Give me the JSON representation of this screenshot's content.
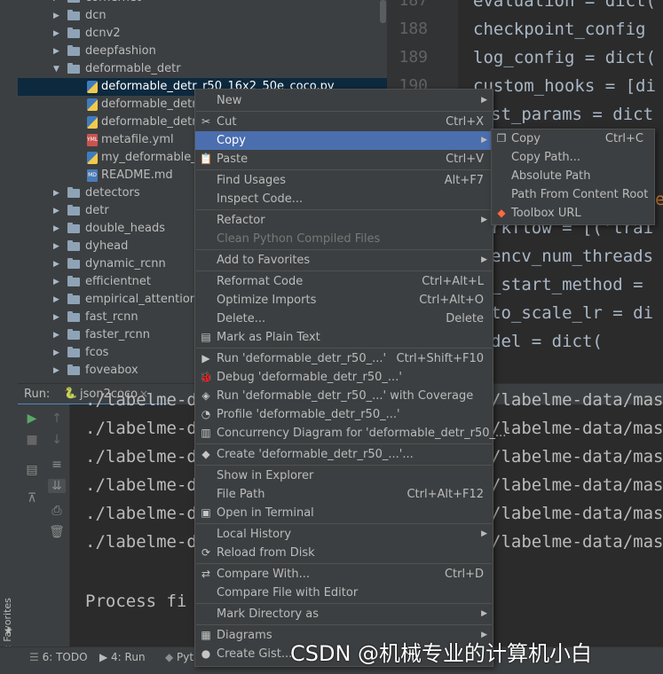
{
  "tree": {
    "items": [
      {
        "label": "cornernet",
        "type": "folder",
        "indent": 0,
        "expanded": false
      },
      {
        "label": "dcn",
        "type": "folder",
        "indent": 0,
        "expanded": false
      },
      {
        "label": "dcnv2",
        "type": "folder",
        "indent": 0,
        "expanded": false
      },
      {
        "label": "deepfashion",
        "type": "folder",
        "indent": 0,
        "expanded": false
      },
      {
        "label": "deformable_detr",
        "type": "folder",
        "indent": 0,
        "expanded": true
      },
      {
        "label": "deformable_detr_r50_16x2_50e_coco.py",
        "type": "py",
        "indent": 1,
        "selected": true
      },
      {
        "label": "deformable_detr_r",
        "type": "py",
        "indent": 1
      },
      {
        "label": "deformable_detr_t",
        "type": "py",
        "indent": 1
      },
      {
        "label": "metafile.yml",
        "type": "yml",
        "indent": 1
      },
      {
        "label": "my_deformable_de",
        "type": "py",
        "indent": 1
      },
      {
        "label": "README.md",
        "type": "md",
        "indent": 1
      },
      {
        "label": "detectors",
        "type": "folder",
        "indent": 0,
        "expanded": false
      },
      {
        "label": "detr",
        "type": "folder",
        "indent": 0,
        "expanded": false
      },
      {
        "label": "double_heads",
        "type": "folder",
        "indent": 0,
        "expanded": false
      },
      {
        "label": "dyhead",
        "type": "folder",
        "indent": 0,
        "expanded": false
      },
      {
        "label": "dynamic_rcnn",
        "type": "folder",
        "indent": 0,
        "expanded": false
      },
      {
        "label": "efficientnet",
        "type": "folder",
        "indent": 0,
        "expanded": false
      },
      {
        "label": "empirical_attention",
        "type": "folder",
        "indent": 0,
        "expanded": false
      },
      {
        "label": "fast_rcnn",
        "type": "folder",
        "indent": 0,
        "expanded": false
      },
      {
        "label": "faster_rcnn",
        "type": "folder",
        "indent": 0,
        "expanded": false
      },
      {
        "label": "fcos",
        "type": "folder",
        "indent": 0,
        "expanded": false
      },
      {
        "label": "foveabox",
        "type": "folder",
        "indent": 0,
        "expanded": false
      }
    ]
  },
  "editor": {
    "line_numbers": [
      "187",
      "188",
      "189",
      "190"
    ],
    "lines": [
      {
        "name": "evaluation",
        "text": "evaluation = dict("
      },
      {
        "name": "checkpoint",
        "text": "checkpoint_config"
      },
      {
        "name": "log",
        "text": "log_config = dict("
      },
      {
        "name": "custom-hooks",
        "text": "custom_hooks = [di"
      },
      {
        "name": "test-params",
        "text": "st_params = dict"
      },
      {
        "name": "line6",
        "text": "' "
      },
      {
        "name": "line7",
        "text": "e"
      },
      {
        "name": "workflow",
        "text": "rkflow = [('trai"
      },
      {
        "name": "opencv",
        "text": "encv_num_threads"
      },
      {
        "name": "start-method",
        "text": "_start_method ="
      },
      {
        "name": "auto-scale",
        "text": "to_scale_lr = di"
      },
      {
        "name": "model",
        "text": "del = dict("
      }
    ]
  },
  "run": {
    "label": "Run:",
    "tab": "json2coco",
    "console_prefix": "./labelme-d",
    "console_suffix": "/labelme-data/mas",
    "console_lines": 6,
    "process_text": "Process fi"
  },
  "menu": {
    "items": [
      {
        "label": "New",
        "shortcut": "",
        "submenu": true,
        "icon": ""
      },
      {
        "sep": true
      },
      {
        "label": "Cut",
        "shortcut": "Ctrl+X",
        "icon": "✂"
      },
      {
        "label": "Copy",
        "shortcut": "",
        "submenu": true,
        "highlighted": true,
        "icon": ""
      },
      {
        "label": "Paste",
        "shortcut": "Ctrl+V",
        "icon": "📋"
      },
      {
        "sep": true
      },
      {
        "label": "Find Usages",
        "shortcut": "Alt+F7",
        "icon": ""
      },
      {
        "label": "Inspect Code...",
        "shortcut": "",
        "icon": ""
      },
      {
        "sep": true
      },
      {
        "label": "Refactor",
        "shortcut": "",
        "submenu": true,
        "icon": ""
      },
      {
        "label": "Clean Python Compiled Files",
        "shortcut": "",
        "disabled": true,
        "icon": ""
      },
      {
        "sep": true
      },
      {
        "label": "Add to Favorites",
        "shortcut": "",
        "submenu": true,
        "icon": ""
      },
      {
        "sep": true
      },
      {
        "label": "Reformat Code",
        "shortcut": "Ctrl+Alt+L",
        "icon": ""
      },
      {
        "label": "Optimize Imports",
        "shortcut": "Ctrl+Alt+O",
        "icon": ""
      },
      {
        "label": "Delete...",
        "shortcut": "Delete",
        "icon": ""
      },
      {
        "label": "Mark as Plain Text",
        "shortcut": "",
        "icon": "▤"
      },
      {
        "sep": true
      },
      {
        "label": "Run 'deformable_detr_r50_...'",
        "shortcut": "Ctrl+Shift+F10",
        "icon": "▶"
      },
      {
        "label": "Debug 'deformable_detr_r50_...'",
        "shortcut": "",
        "icon": "🐞"
      },
      {
        "label": "Run 'deformable_detr_r50_...' with Coverage",
        "shortcut": "",
        "icon": "◈"
      },
      {
        "label": "Profile 'deformable_detr_r50_...'",
        "shortcut": "",
        "icon": "◔"
      },
      {
        "label": "Concurrency Diagram for 'deformable_detr_r50_...'",
        "shortcut": "",
        "icon": "▥"
      },
      {
        "sep": true
      },
      {
        "label": "Create 'deformable_detr_r50_...'...",
        "shortcut": "",
        "icon": "◆"
      },
      {
        "sep": true
      },
      {
        "label": "Show in Explorer",
        "shortcut": "",
        "icon": ""
      },
      {
        "label": "File Path",
        "shortcut": "Ctrl+Alt+F12",
        "icon": ""
      },
      {
        "label": "Open in Terminal",
        "shortcut": "",
        "icon": "▣"
      },
      {
        "sep": true
      },
      {
        "label": "Local History",
        "shortcut": "",
        "submenu": true,
        "icon": ""
      },
      {
        "label": "Reload from Disk",
        "shortcut": "",
        "icon": "⟳"
      },
      {
        "sep": true
      },
      {
        "label": "Compare With...",
        "shortcut": "Ctrl+D",
        "icon": "⇄"
      },
      {
        "label": "Compare File with Editor",
        "shortcut": "",
        "icon": ""
      },
      {
        "sep": true
      },
      {
        "label": "Mark Directory as",
        "shortcut": "",
        "submenu": true,
        "icon": ""
      },
      {
        "sep": true
      },
      {
        "label": "Diagrams",
        "shortcut": "",
        "submenu": true,
        "icon": "▦"
      },
      {
        "label": "Create Gist...",
        "shortcut": "",
        "icon": "●"
      }
    ]
  },
  "submenu": {
    "items": [
      {
        "label": "Copy",
        "shortcut": "Ctrl+C",
        "icon": "❐"
      },
      {
        "label": "Copy Path...",
        "shortcut": "",
        "icon": ""
      },
      {
        "label": "Absolute Path",
        "shortcut": "",
        "icon": ""
      },
      {
        "label": "Path From Content Root",
        "shortcut": "",
        "icon": ""
      },
      {
        "label": "Toolbox URL",
        "shortcut": "",
        "icon": "◆"
      }
    ]
  },
  "bottombar": {
    "todo": "6: TODO",
    "run": "4: Run",
    "python": "Pyt"
  },
  "favorites": "2: Favorites",
  "watermark": "CSDN @机械专业的计算机小白"
}
